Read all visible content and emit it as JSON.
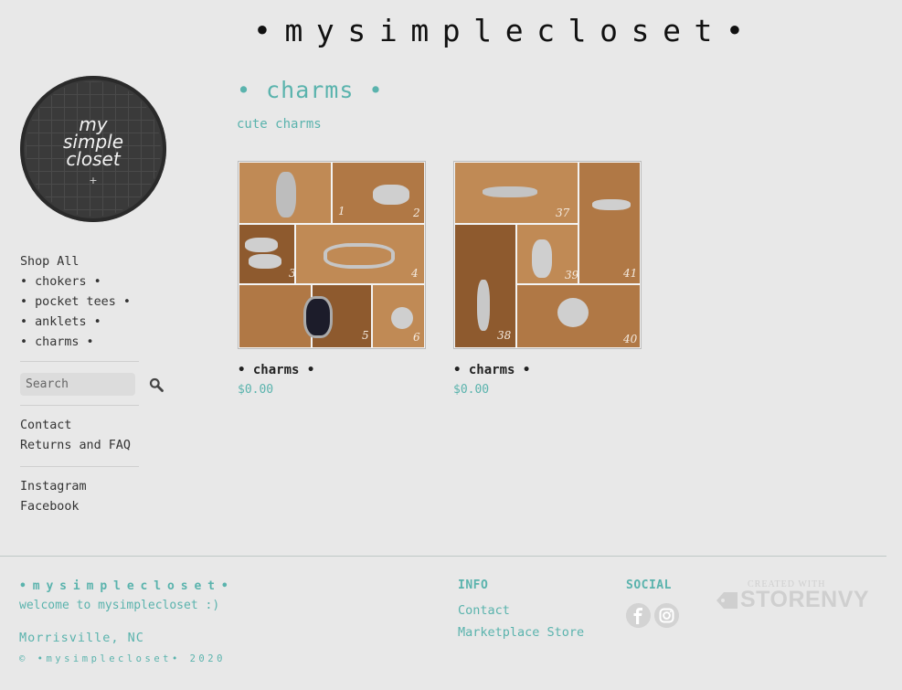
{
  "header": {
    "site_title": "•mysimplecloset•"
  },
  "logo": {
    "line1": "my",
    "line2": "simple",
    "line3": "closet",
    "mark": "+"
  },
  "sidebar": {
    "nav": [
      {
        "label": "Shop All"
      },
      {
        "label": "• chokers •"
      },
      {
        "label": "• pocket tees •"
      },
      {
        "label": "• anklets •"
      },
      {
        "label": "• charms •"
      }
    ],
    "search": {
      "placeholder": "Search",
      "icon": "search-icon"
    },
    "pages": [
      {
        "label": "Contact"
      },
      {
        "label": "Returns and FAQ"
      }
    ],
    "social": [
      {
        "label": "Instagram"
      },
      {
        "label": "Facebook"
      }
    ]
  },
  "main": {
    "title": "• charms •",
    "subtitle": "cute charms",
    "products": [
      {
        "name": "• charms •",
        "price": "$0.00",
        "numbers": [
          "1",
          "2",
          "3",
          "4",
          "5",
          "6"
        ]
      },
      {
        "name": "• charms •",
        "price": "$0.00",
        "numbers": [
          "37",
          "41",
          "39",
          "38",
          "40"
        ]
      }
    ]
  },
  "footer": {
    "brand": "•mysimplecloset•",
    "tagline": "welcome to mysimplecloset :)",
    "location": "Morrisville, NC",
    "copyright": "© •mysimplecloset• 2020",
    "info_heading": "INFO",
    "info_links": [
      {
        "label": "Contact"
      },
      {
        "label": "Marketplace Store"
      }
    ],
    "social_heading": "SOCIAL",
    "social_icons": [
      "facebook-icon",
      "instagram-icon"
    ],
    "storenvy_small": "CREATED WITH",
    "storenvy_big": "STORENVY"
  },
  "colors": {
    "accent": "#5ab3ad",
    "background": "#e8e8e8",
    "text": "#333333"
  }
}
